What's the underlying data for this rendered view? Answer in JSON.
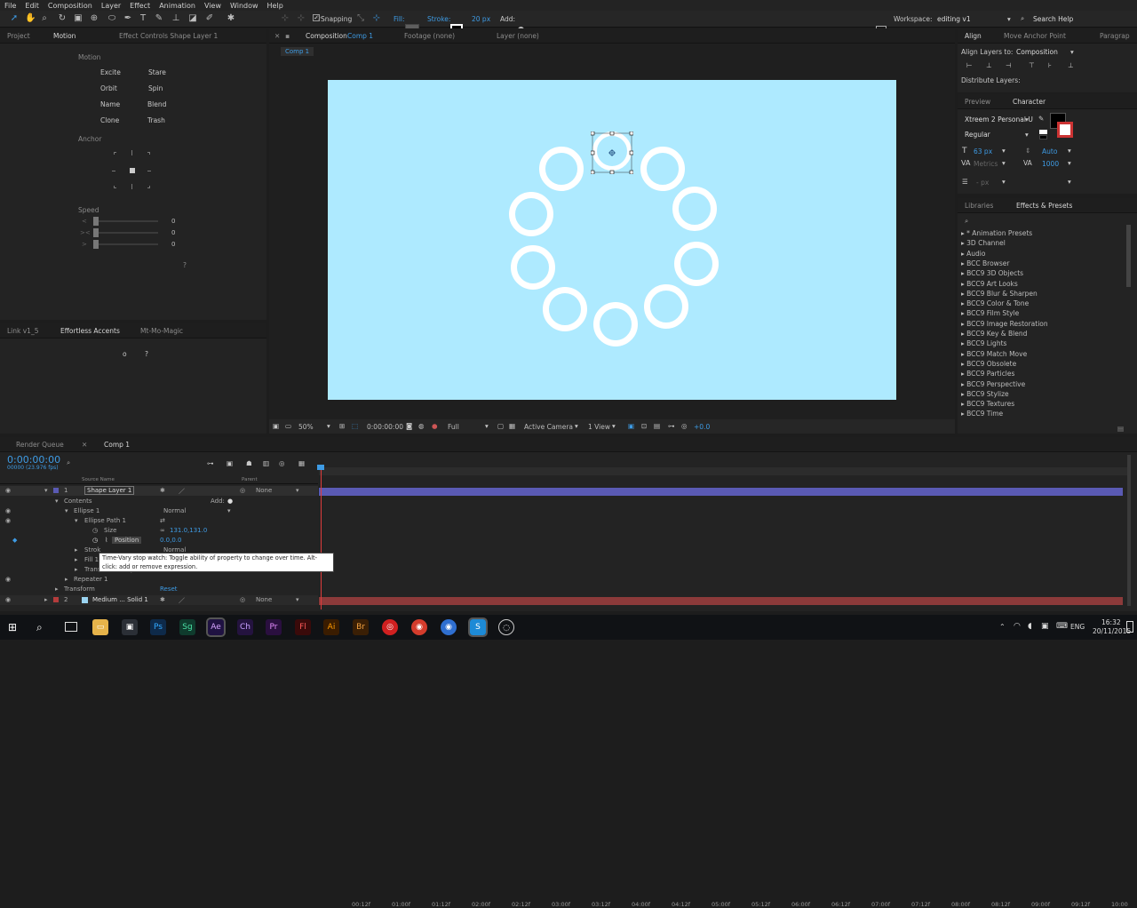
{
  "menu": [
    "File",
    "Edit",
    "Composition",
    "Layer",
    "Effect",
    "Animation",
    "View",
    "Window",
    "Help"
  ],
  "toolbar": {
    "snapping": "Snapping",
    "fill": "Fill:",
    "stroke": "Stroke:",
    "stroke_width": "20 px",
    "add": "Add:",
    "workspace_label": "Workspace:",
    "workspace_value": "editing v1",
    "search_help": "Search Help"
  },
  "left_panel": {
    "tabs": [
      "Project",
      "Motion",
      "Effect Controls Shape Layer 1"
    ],
    "motion_title": "Motion",
    "motion_buttons": [
      "Excite",
      "Stare",
      "Orbit",
      "Spin",
      "Name",
      "Blend",
      "Clone",
      "Trash"
    ],
    "anchor_title": "Anchor",
    "speed_title": "Speed",
    "speed_values": [
      "0",
      "0",
      "0"
    ],
    "help": "?",
    "bottom_tabs": [
      "Link v1_5",
      "Effortless Accents",
      "Mt-Mo-Magic"
    ],
    "bottom_buttons": [
      "o",
      "?"
    ]
  },
  "comp_panel": {
    "tabs": [
      "Composition",
      "Comp 1",
      "Footage (none)",
      "Layer (none)"
    ],
    "comp_tab": "Comp 1",
    "zoom": "50%",
    "timecode": "0:00:00:00",
    "resolution": "Full",
    "camera": "Active Camera",
    "view": "1 View",
    "exposure": "+0.0",
    "bg_color": "#aeeaff"
  },
  "right_panel": {
    "align_tabs": [
      "Align",
      "Move Anchor Point",
      "Paragrap"
    ],
    "align_layers_to": "Align Layers to:",
    "align_target": "Composition",
    "distribute": "Distribute Layers:",
    "char_tabs": [
      "Preview",
      "Character"
    ],
    "font": "Xtreem 2 Personal U",
    "style": "Regular",
    "font_size": "63 px",
    "leading": "Auto",
    "kerning": "Metrics",
    "tracking": "1000",
    "indent": "- px",
    "effects_tabs": [
      "Libraries",
      "Effects & Presets"
    ],
    "effects": [
      "* Animation Presets",
      "3D Channel",
      "Audio",
      "BCC Browser",
      "BCC9 3D Objects",
      "BCC9 Art Looks",
      "BCC9 Blur & Sharpen",
      "BCC9 Color & Tone",
      "BCC9 Film Style",
      "BCC9 Image Restoration",
      "BCC9 Key & Blend",
      "BCC9 Lights",
      "BCC9 Match Move",
      "BCC9 Obsolete",
      "BCC9 Particles",
      "BCC9 Perspective",
      "BCC9 Stylize",
      "BCC9 Textures",
      "BCC9 Time"
    ]
  },
  "timeline": {
    "tabs": [
      "Render Queue",
      "Comp 1"
    ],
    "timecode": "0:00:00:00",
    "fps": "00000 (23.976 fps)",
    "col_source": "Source Name",
    "col_parent": "Parent",
    "ruler": [
      "00:12f",
      "01:00f",
      "01:12f",
      "02:00f",
      "02:12f",
      "03:00f",
      "03:12f",
      "04:00f",
      "04:12f",
      "05:00f",
      "05:12f",
      "06:00f",
      "06:12f",
      "07:00f",
      "07:12f",
      "08:00f",
      "08:12f",
      "09:00f",
      "09:12f",
      "10:00"
    ],
    "layer1_num": "1",
    "layer1_name": "Shape Layer 1",
    "layer1_parent": "None",
    "contents": "Contents",
    "add": "Add:",
    "ellipse": "Ellipse 1",
    "blend": "Normal",
    "ellipse_path": "Ellipse Path 1",
    "size_label": "Size",
    "size_value": "131.0,131.0",
    "position_label": "Position",
    "position_value": "0.0,0.0",
    "stroke": "Strok",
    "fill": "Fill 1",
    "transform_ellipse": "Transform : Ellipse 1",
    "repeater": "Repeater 1",
    "transform": "Transform",
    "reset": "Reset",
    "layer2_num": "2",
    "layer2_name": "Medium ... Solid 1",
    "layer2_parent": "None",
    "tooltip": "Time-Vary stop watch: Toggle ability of property to change over time. Alt-click: add or remove expression.",
    "normal2": "Normal"
  },
  "taskbar": {
    "time": "16:32",
    "date": "20/11/2015",
    "lang": "ENG",
    "apps": [
      "Ps",
      "Sg",
      "Ae",
      "Ch",
      "Pr",
      "Fl",
      "Ai",
      "Br"
    ]
  }
}
